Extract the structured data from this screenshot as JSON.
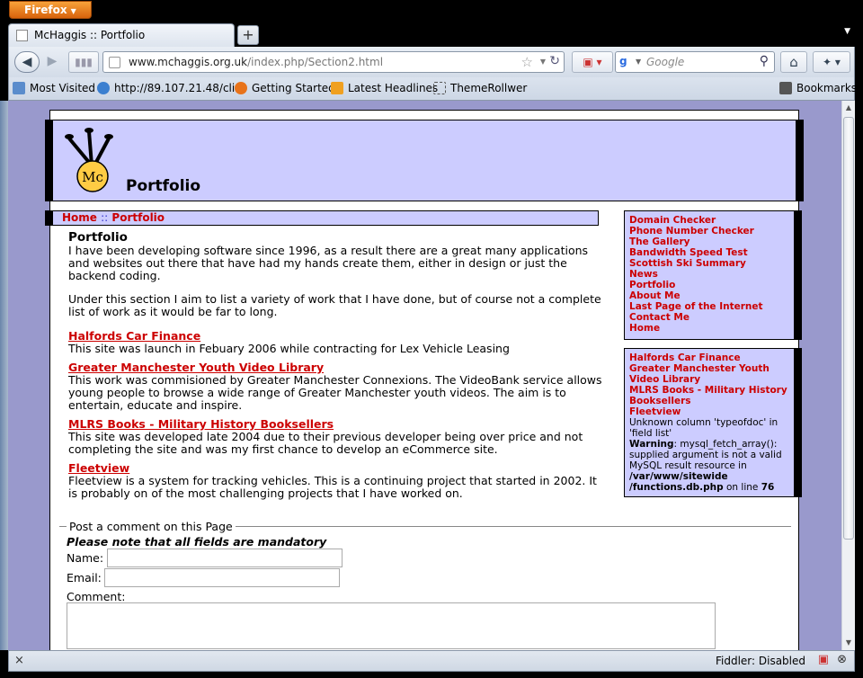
{
  "browser": {
    "menu_label": "Firefox",
    "tab_title": "McHaggis :: Portfolio",
    "newtab_symbol": "+",
    "url_domain": "www.mchaggis.org.uk",
    "url_path": "/index.php/Section2.html",
    "search_engine": "g",
    "search_placeholder": "Google",
    "bookmarks": {
      "most_visited": "Most Visited",
      "ip_link": "http://89.107.21.48/cli...",
      "getting_started": "Getting Started",
      "latest_headlines": "Latest Headlines",
      "themerollwer": "ThemeRollwer",
      "bookmarks": "Bookmarks"
    },
    "status": {
      "close": "×",
      "fiddler": "Fiddler: Disabled"
    }
  },
  "page": {
    "title": "Portfolio",
    "logo_text": "Mc",
    "breadcrumb": {
      "home": "Home",
      "sep": "::",
      "current": "Portfolio"
    },
    "main": {
      "heading": "Portfolio",
      "intro1": "I have been developing software since 1996, as a result there are a great many applications and websites out there that have had my hands create them, either in design or just the backend coding.",
      "intro2": "Under this section I aim to list a variety of work that I have done, but of course not a complete list of work as it would be far to long.",
      "projects": [
        {
          "title": "Halfords Car Finance",
          "desc": "This site was launch in Febuary 2006 while contracting for Lex Vehicle Leasing"
        },
        {
          "title": "Greater Manchester Youth Video Library",
          "desc": "This work was commisioned by Greater Manchester Connexions. The VideoBank service allows young people to browse a wide range of Greater Manchester youth videos. The aim is to entertain, educate and inspire."
        },
        {
          "title": "MLRS Books - Military History Booksellers",
          "desc": "This site was developed late 2004 due to their previous developer being over price and not completing the site and was my first chance to develop an eCommerce site."
        },
        {
          "title": "Fleetview",
          "desc": "Fleetview is a system for tracking vehicles. This is a continuing project that started in 2002. It is probably on of the most challenging projects that I have worked on."
        }
      ]
    },
    "sidebar_nav": [
      "Domain Checker",
      "Phone Number Checker",
      "The Gallery",
      "Bandwidth Speed Test",
      "Scottish Ski Summary",
      "News",
      "Portfolio",
      "About Me",
      "Last Page of the Internet",
      "Contact Me",
      "Home"
    ],
    "sidebar_projects": [
      "Halfords Car Finance",
      "Greater Manchester Youth Video Library",
      "MLRS Books - Military History Booksellers",
      "Fleetview"
    ],
    "sidebar_error": {
      "line1": "Unknown column 'typeofdoc' in 'field list'",
      "warning_label": "Warning",
      "warning_text": ": mysql_fetch_array(): supplied argument is not a valid MySQL result resource in ",
      "path": "/var/www/sitewide /functions.db.php",
      "on_line": " on line ",
      "line_no": "76"
    },
    "comment_form": {
      "legend": "Post a comment on this Page",
      "mandatory": "Please note that all fields are mandatory",
      "name_label": "Name:",
      "email_label": "Email:",
      "comment_label": "Comment:"
    }
  },
  "colors": {
    "accent": "#ccccff",
    "link": "#cc0000",
    "background": "#9999cc"
  }
}
